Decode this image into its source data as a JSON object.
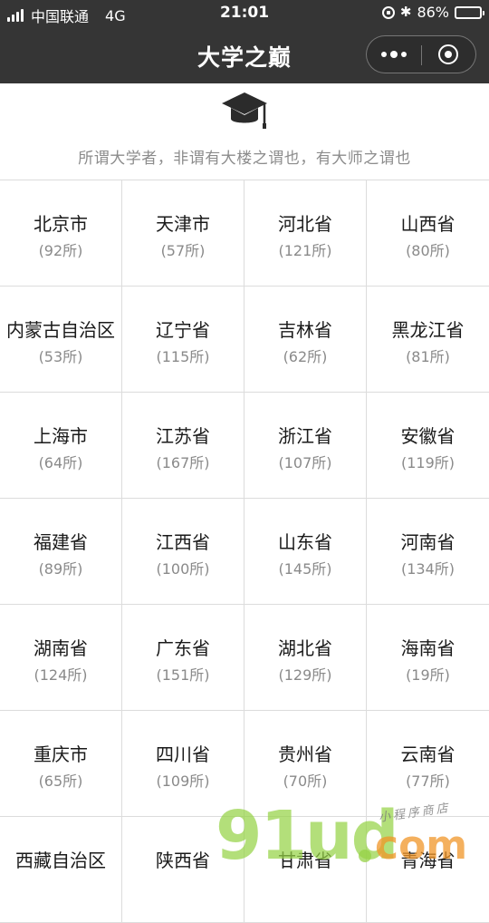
{
  "status_bar": {
    "carrier": "中国联通",
    "network": "4G",
    "time": "21:01",
    "battery": "86%",
    "battery_level": 0.86
  },
  "title_bar": {
    "title": "大学之巅"
  },
  "header": {
    "icon": "graduation-cap-icon",
    "motto": "所谓大学者，非谓有大楼之谓也，有大师之谓也"
  },
  "provinces": [
    {
      "name": "北京市",
      "count": "(92所)"
    },
    {
      "name": "天津市",
      "count": "(57所)"
    },
    {
      "name": "河北省",
      "count": "(121所)"
    },
    {
      "name": "山西省",
      "count": "(80所)"
    },
    {
      "name": "内蒙古自治区",
      "count": "(53所)"
    },
    {
      "name": "辽宁省",
      "count": "(115所)"
    },
    {
      "name": "吉林省",
      "count": "(62所)"
    },
    {
      "name": "黑龙江省",
      "count": "(81所)"
    },
    {
      "name": "上海市",
      "count": "(64所)"
    },
    {
      "name": "江苏省",
      "count": "(167所)"
    },
    {
      "name": "浙江省",
      "count": "(107所)"
    },
    {
      "name": "安徽省",
      "count": "(119所)"
    },
    {
      "name": "福建省",
      "count": "(89所)"
    },
    {
      "name": "江西省",
      "count": "(100所)"
    },
    {
      "name": "山东省",
      "count": "(145所)"
    },
    {
      "name": "河南省",
      "count": "(134所)"
    },
    {
      "name": "湖南省",
      "count": "(124所)"
    },
    {
      "name": "广东省",
      "count": "(151所)"
    },
    {
      "name": "湖北省",
      "count": "(129所)"
    },
    {
      "name": "海南省",
      "count": "(19所)"
    },
    {
      "name": "重庆市",
      "count": "(65所)"
    },
    {
      "name": "四川省",
      "count": "(109所)"
    },
    {
      "name": "贵州省",
      "count": "(70所)"
    },
    {
      "name": "云南省",
      "count": "(77所)"
    },
    {
      "name": "西藏自治区",
      "count": ""
    },
    {
      "name": "陕西省",
      "count": ""
    },
    {
      "name": "甘肃省",
      "count": ""
    },
    {
      "name": "青海省",
      "count": ""
    }
  ],
  "watermark": {
    "brand": "91ud",
    "suffix": "com",
    "tagline": "小程序商店"
  },
  "colors": {
    "nav_background": "#353535",
    "grid_line": "#dcdcdc",
    "muted_text": "#8a8a8a",
    "watermark_green": "#96d246",
    "watermark_orange": "#f09628"
  }
}
